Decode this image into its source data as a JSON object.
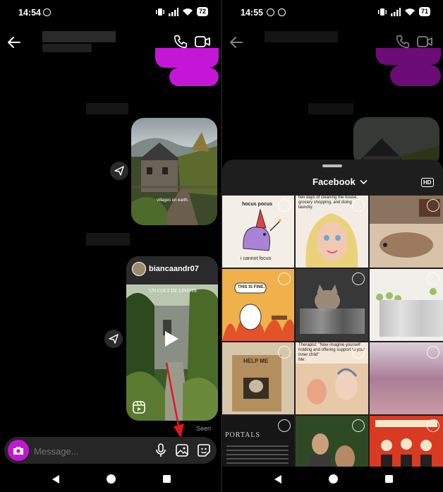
{
  "left": {
    "status": {
      "time": "14:54",
      "battery": "72"
    },
    "seen_label": "Seen",
    "reel_username": "biancaandr07",
    "post1_caption": "villages on earth.",
    "reel_overlay_text": "UN COLT DE LINISTE",
    "composer": {
      "placeholder": "Message..."
    }
  },
  "right": {
    "status": {
      "time": "14:55",
      "battery": "71"
    },
    "sheet": {
      "album": "Facebook",
      "hd_badge": "HD"
    },
    "gallery": {
      "hocus_top": "hocus pocus",
      "hocus_bottom": "i cannot focus",
      "note_text": "two days of cleaning the house, grocery shopping, and doing laundry.",
      "fine_text": "THIS IS FINE.",
      "therapist_text": "Therapist: \"Now imagine yourself holding and offering support to your inner child\"\nMe:",
      "box_text": "HELP ME",
      "portals_text": "PORTALS"
    }
  },
  "colors": {
    "accent": "#c516d8",
    "bg": "#000000",
    "sheet": "#1e1e1e"
  }
}
